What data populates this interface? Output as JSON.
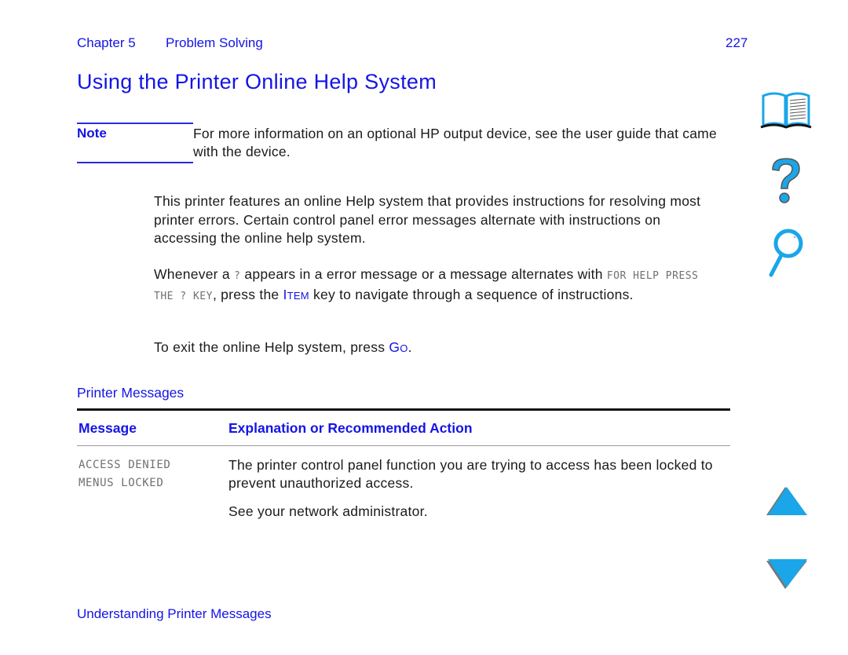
{
  "header": {
    "chapter": "Chapter 5",
    "section": "Problem Solving",
    "page_number": "227"
  },
  "title": "Using the Printer Online Help System",
  "note": {
    "label": "Note",
    "text": "For more information on an optional HP output device, see the user guide that came with the device."
  },
  "paragraphs": {
    "p1": "This printer features an online Help system that provides instructions for resolving most printer errors. Certain control panel error messages alternate with instructions on accessing the online help system.",
    "p2_before": "Whenever a ",
    "p2_code1": "?",
    "p2_mid": " appears in a error message or a message alternates with ",
    "p2_code2": "FOR HELP PRESS THE ? KEY",
    "p2_after1": ", press the ",
    "p2_key_initial": "I",
    "p2_key_rest": "TEM",
    "p2_after2": " key to navigate through a sequence of instructions.",
    "p3_before": "To exit the online Help system, press ",
    "p3_key_initial": "G",
    "p3_key_rest": "O",
    "p3_after": "."
  },
  "subheading": "Printer Messages",
  "table": {
    "columns": [
      "Message",
      "Explanation or Recommended Action"
    ],
    "rows": [
      {
        "message_lines": [
          "ACCESS DENIED",
          "MENUS LOCKED"
        ],
        "explanation": "The printer control panel function you are trying to access has been locked to prevent unauthorized access.",
        "explanation2": "See your network administrator."
      }
    ]
  },
  "footer": "Understanding Printer Messages",
  "nav_icons": [
    "book-icon",
    "help-question-icon",
    "search-magnifier-icon",
    "previous-page-arrow-icon",
    "next-page-arrow-icon"
  ],
  "colors": {
    "heading_blue": "#1414e6",
    "icon_cyan": "#1aa6e8"
  }
}
